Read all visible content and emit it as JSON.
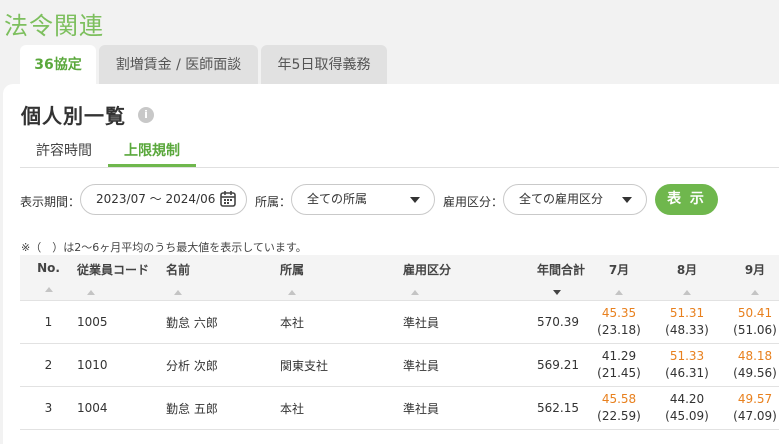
{
  "page_title": "法令関連",
  "tabs": [
    {
      "label": "36協定",
      "active": true
    },
    {
      "label": "割増賃金 / 医師面談",
      "active": false
    },
    {
      "label": "年5日取得義務",
      "active": false
    }
  ],
  "section": {
    "title": "個人別一覧",
    "info_icon": "i"
  },
  "subtabs": [
    {
      "label": "許容時間",
      "active": false
    },
    {
      "label": "上限規制",
      "active": true
    }
  ],
  "filters": {
    "period_label": "表示期間：",
    "period_value": "2023/07 〜 2024/06",
    "dept_label": "所属：",
    "dept_value": "全ての所属",
    "type_label": "雇用区分：",
    "type_value": "全ての雇用区分",
    "show_button": "表 示"
  },
  "note": "※（　）は2〜6ヶ月平均のうち最大値を表示しています。",
  "colors": {
    "accent": "#6fb74d",
    "title_green": "#7dbf5e",
    "warning_orange": "#e8801e"
  },
  "table": {
    "headers": {
      "no": "No.",
      "code": "従業員コード",
      "name": "名前",
      "dept": "所属",
      "type": "雇用区分",
      "total": "年間合計",
      "m7": "7月",
      "m8": "8月",
      "m9": "9月"
    },
    "rows": [
      {
        "no": "1",
        "code": "1005",
        "name": "勤怠 六郎",
        "dept": "本社",
        "type": "準社員",
        "total": "570.39",
        "m7": "45.35",
        "m7_avg": "(23.18)",
        "m8": "51.31",
        "m8_avg": "(48.33)",
        "m9": "50.41",
        "m9_avg": "(51.06)"
      },
      {
        "no": "2",
        "code": "1010",
        "name": "分析 次郎",
        "dept": "関東支社",
        "type": "準社員",
        "total": "569.21",
        "m7": "41.29",
        "m7_avg": "(21.45)",
        "m8": "51.33",
        "m8_avg": "(46.31)",
        "m9": "48.18",
        "m9_avg": "(49.56)"
      },
      {
        "no": "3",
        "code": "1004",
        "name": "勤怠 五郎",
        "dept": "本社",
        "type": "準社員",
        "total": "562.15",
        "m7": "45.58",
        "m7_avg": "(22.59)",
        "m8": "44.20",
        "m8_avg": "(45.09)",
        "m9": "49.57",
        "m9_avg": "(47.09)"
      }
    ]
  }
}
